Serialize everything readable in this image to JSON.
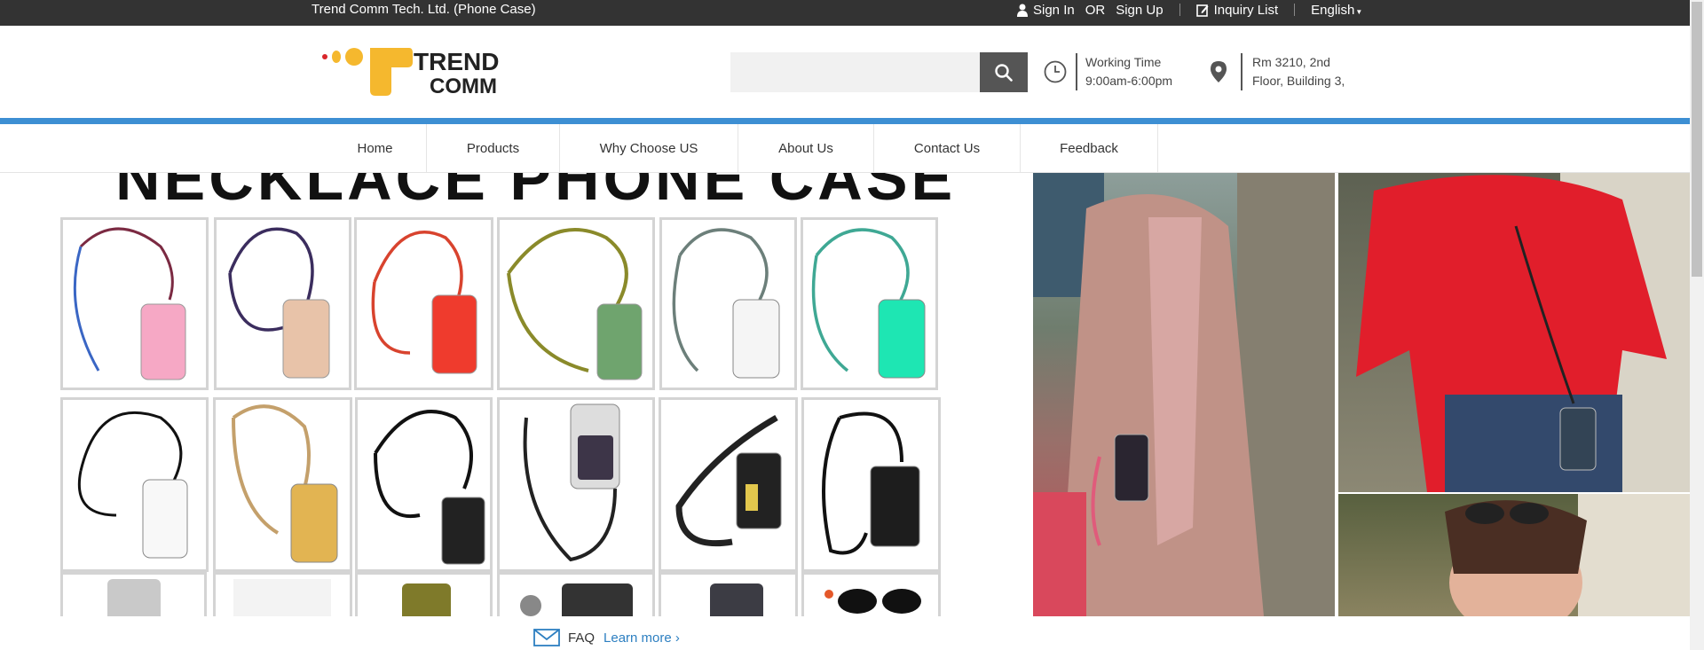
{
  "topbar": {
    "company": "Trend Comm Tech. Ltd. (Phone Case)",
    "sign_in": "Sign In",
    "or": "OR",
    "sign_up": "Sign Up",
    "inquiry": "Inquiry List",
    "language": "English"
  },
  "header": {
    "logo_line1": "TREND",
    "logo_line2": "COMM",
    "search": {
      "placeholder": "",
      "value": ""
    },
    "working_label": "Working Time",
    "working_hours": "9:00am-6:00pm",
    "address_line1": "Rm 3210, 2nd",
    "address_line2": "Floor, Building 3,"
  },
  "nav": {
    "items": [
      {
        "label": "Home"
      },
      {
        "label": "Products"
      },
      {
        "label": "Why Choose US"
      },
      {
        "label": "About Us"
      },
      {
        "label": "Contact Us"
      },
      {
        "label": "Feedback"
      }
    ]
  },
  "banner": {
    "title": "NECKLACE PHONE CASE"
  },
  "faq": {
    "label": "FAQ",
    "link": "Learn more ›"
  },
  "colors": {
    "topbar": "#333333",
    "accent_blue": "#3d8fd3",
    "link_blue": "#2d7fc1",
    "logo_yellow": "#f5b82e",
    "logo_red": "#d9262a"
  }
}
